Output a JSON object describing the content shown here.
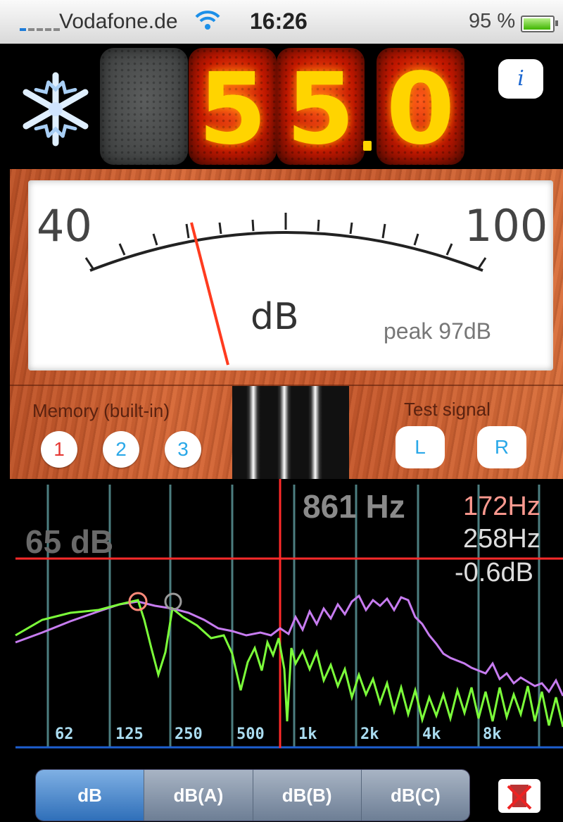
{
  "status_bar": {
    "carrier": "Vodafone.de",
    "time": "16:26",
    "battery": "95 %"
  },
  "display": {
    "digits": [
      "5",
      "5",
      "0"
    ],
    "mode_icon": "snowflake-icon",
    "info_label": "i"
  },
  "meter": {
    "scale_min": "40",
    "scale_max": "100",
    "unit": "dB",
    "peak": "peak 97dB",
    "needle_value": 55
  },
  "memory": {
    "label": "Memory (built-in)",
    "slots": [
      "1",
      "2",
      "3"
    ]
  },
  "test_signal": {
    "label": "Test signal",
    "buttons": [
      "L",
      "R"
    ]
  },
  "spectrum": {
    "cursor_freq": "861 Hz",
    "level": "65 dB",
    "readout": [
      "172Hz",
      "258Hz",
      "-0.6dB"
    ],
    "freq_labels": [
      "62",
      "125",
      "250",
      "500",
      "1k",
      "2k",
      "4k",
      "8k"
    ]
  },
  "weighting": {
    "options": [
      "dB",
      "dB(A)",
      "dB(B)",
      "dB(C)"
    ],
    "selected": "dB"
  },
  "colors": {
    "green_trace": "#7cff3a",
    "purple_trace": "#c77cf0",
    "cursor": "#ff2a2a",
    "grid": "#5f9ea0",
    "digit": "#ffd400"
  }
}
